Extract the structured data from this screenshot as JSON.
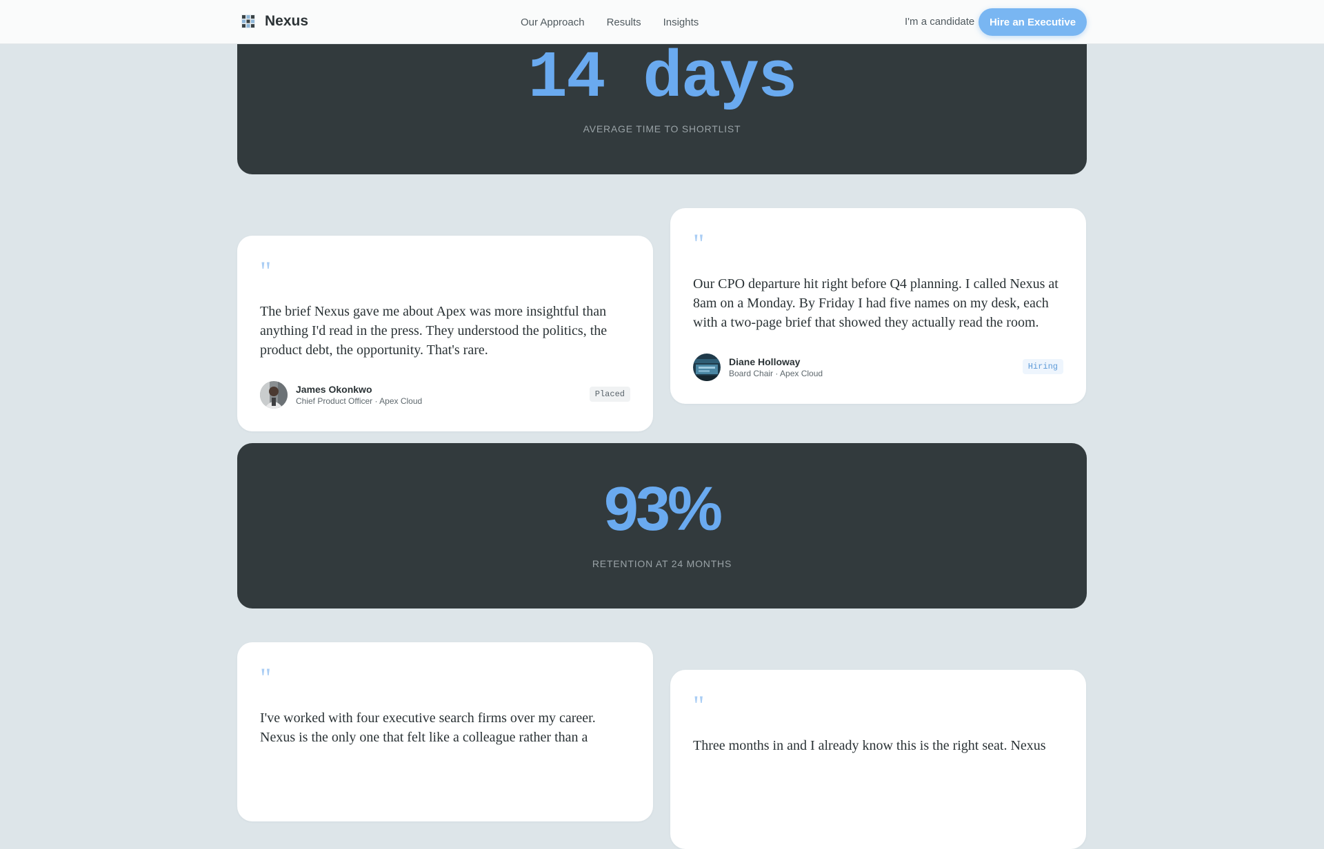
{
  "header": {
    "brand": "Nexus",
    "nav": [
      "Our Approach",
      "Results",
      "Insights"
    ],
    "candidate_link": "I'm a candidate",
    "cta": "Hire an Executive"
  },
  "stats": [
    {
      "value": "14 days",
      "label": "AVERAGE TIME TO SHORTLIST"
    },
    {
      "value": "93%",
      "label": "RETENTION AT 24 MONTHS"
    }
  ],
  "testimonials": [
    {
      "quote_mark": "\"",
      "text": "The brief Nexus gave me about Apex was more insightful than anything I'd read in the press. They understood the politics, the product debt, the opportunity. That's rare.",
      "name": "James Okonkwo",
      "role": "Chief Product Officer · Apex Cloud",
      "tag": "Placed"
    },
    {
      "quote_mark": "\"",
      "text": "Our CPO departure hit right before Q4 planning. I called Nexus at 8am on a Monday. By Friday I had five names on my desk, each with a two-page brief that showed they actually read the room.",
      "name": "Diane Holloway",
      "role": "Board Chair · Apex Cloud",
      "tag": "Hiring"
    },
    {
      "quote_mark": "\"",
      "text": "I've worked with four executive search firms over my career. Nexus is the only one that felt like a colleague rather than a"
    },
    {
      "quote_mark": "\"",
      "text": "Three months in and I already know this is the right seat. Nexus"
    }
  ],
  "colors": {
    "background": "#dde5e9",
    "accent": "#79b6f2",
    "stat_value": "#6aaaf0",
    "stat_block": "#323a3d"
  },
  "icons": {
    "logo": "grid-logo-icon",
    "avatar_1": "person-photo",
    "avatar_2": "person-photo"
  }
}
